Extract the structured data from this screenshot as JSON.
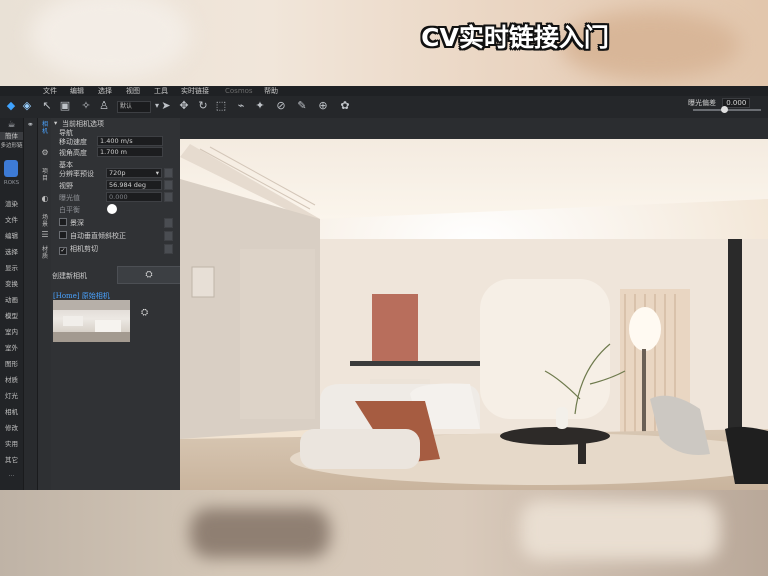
{
  "overlay_title": "CV实时链接入门",
  "menu": {
    "items": [
      "文件",
      "编辑",
      "选择",
      "视图",
      "工具",
      "实时链接",
      "Cosmos",
      "帮助"
    ]
  },
  "toolbar": {
    "preset_value": "默认",
    "exposure_label": "曝光偏差",
    "exposure_value": "0.000",
    "exposure_level": 0.47
  },
  "leftbar": {
    "top_labels": [
      "簡体",
      "多边形链"
    ],
    "brand": "ROKS",
    "items": [
      "渲染",
      "文件",
      "编辑",
      "选择",
      "显示",
      "变换",
      "动画",
      "模型",
      "室内",
      "室外",
      "图形",
      "材质",
      "灯光",
      "相机",
      "修改",
      "实用",
      "其它"
    ],
    "more": "..."
  },
  "side_tabs": [
    "相机",
    "项目",
    "场景",
    "材质"
  ],
  "panel": {
    "section_title": "当前相机选项",
    "nav_title": "导航",
    "move_speed_label": "移动速度",
    "move_speed_value": "1.400 m/s",
    "view_height_label": "视角高度",
    "view_height_value": "1.700 m",
    "basic_title": "基本",
    "resolution_label": "分辨率预设",
    "resolution_value": "720p",
    "fov_label": "视野",
    "fov_value": "56.984 deg",
    "exposure_label": "曝光值",
    "exposure_value": "0.000",
    "white_balance_label": "白平衡",
    "depth_label": "景深",
    "auto_vertical_label": "自动垂直倾斜校正",
    "clipping_label": "相机剪切",
    "create_camera_label": "创建新相机",
    "camera_item": "[Home] 原始相机"
  },
  "colors": {
    "accent_blue": "#4aa3ff",
    "panel_bg": "#303235",
    "toolbar_bg": "#25272a"
  }
}
